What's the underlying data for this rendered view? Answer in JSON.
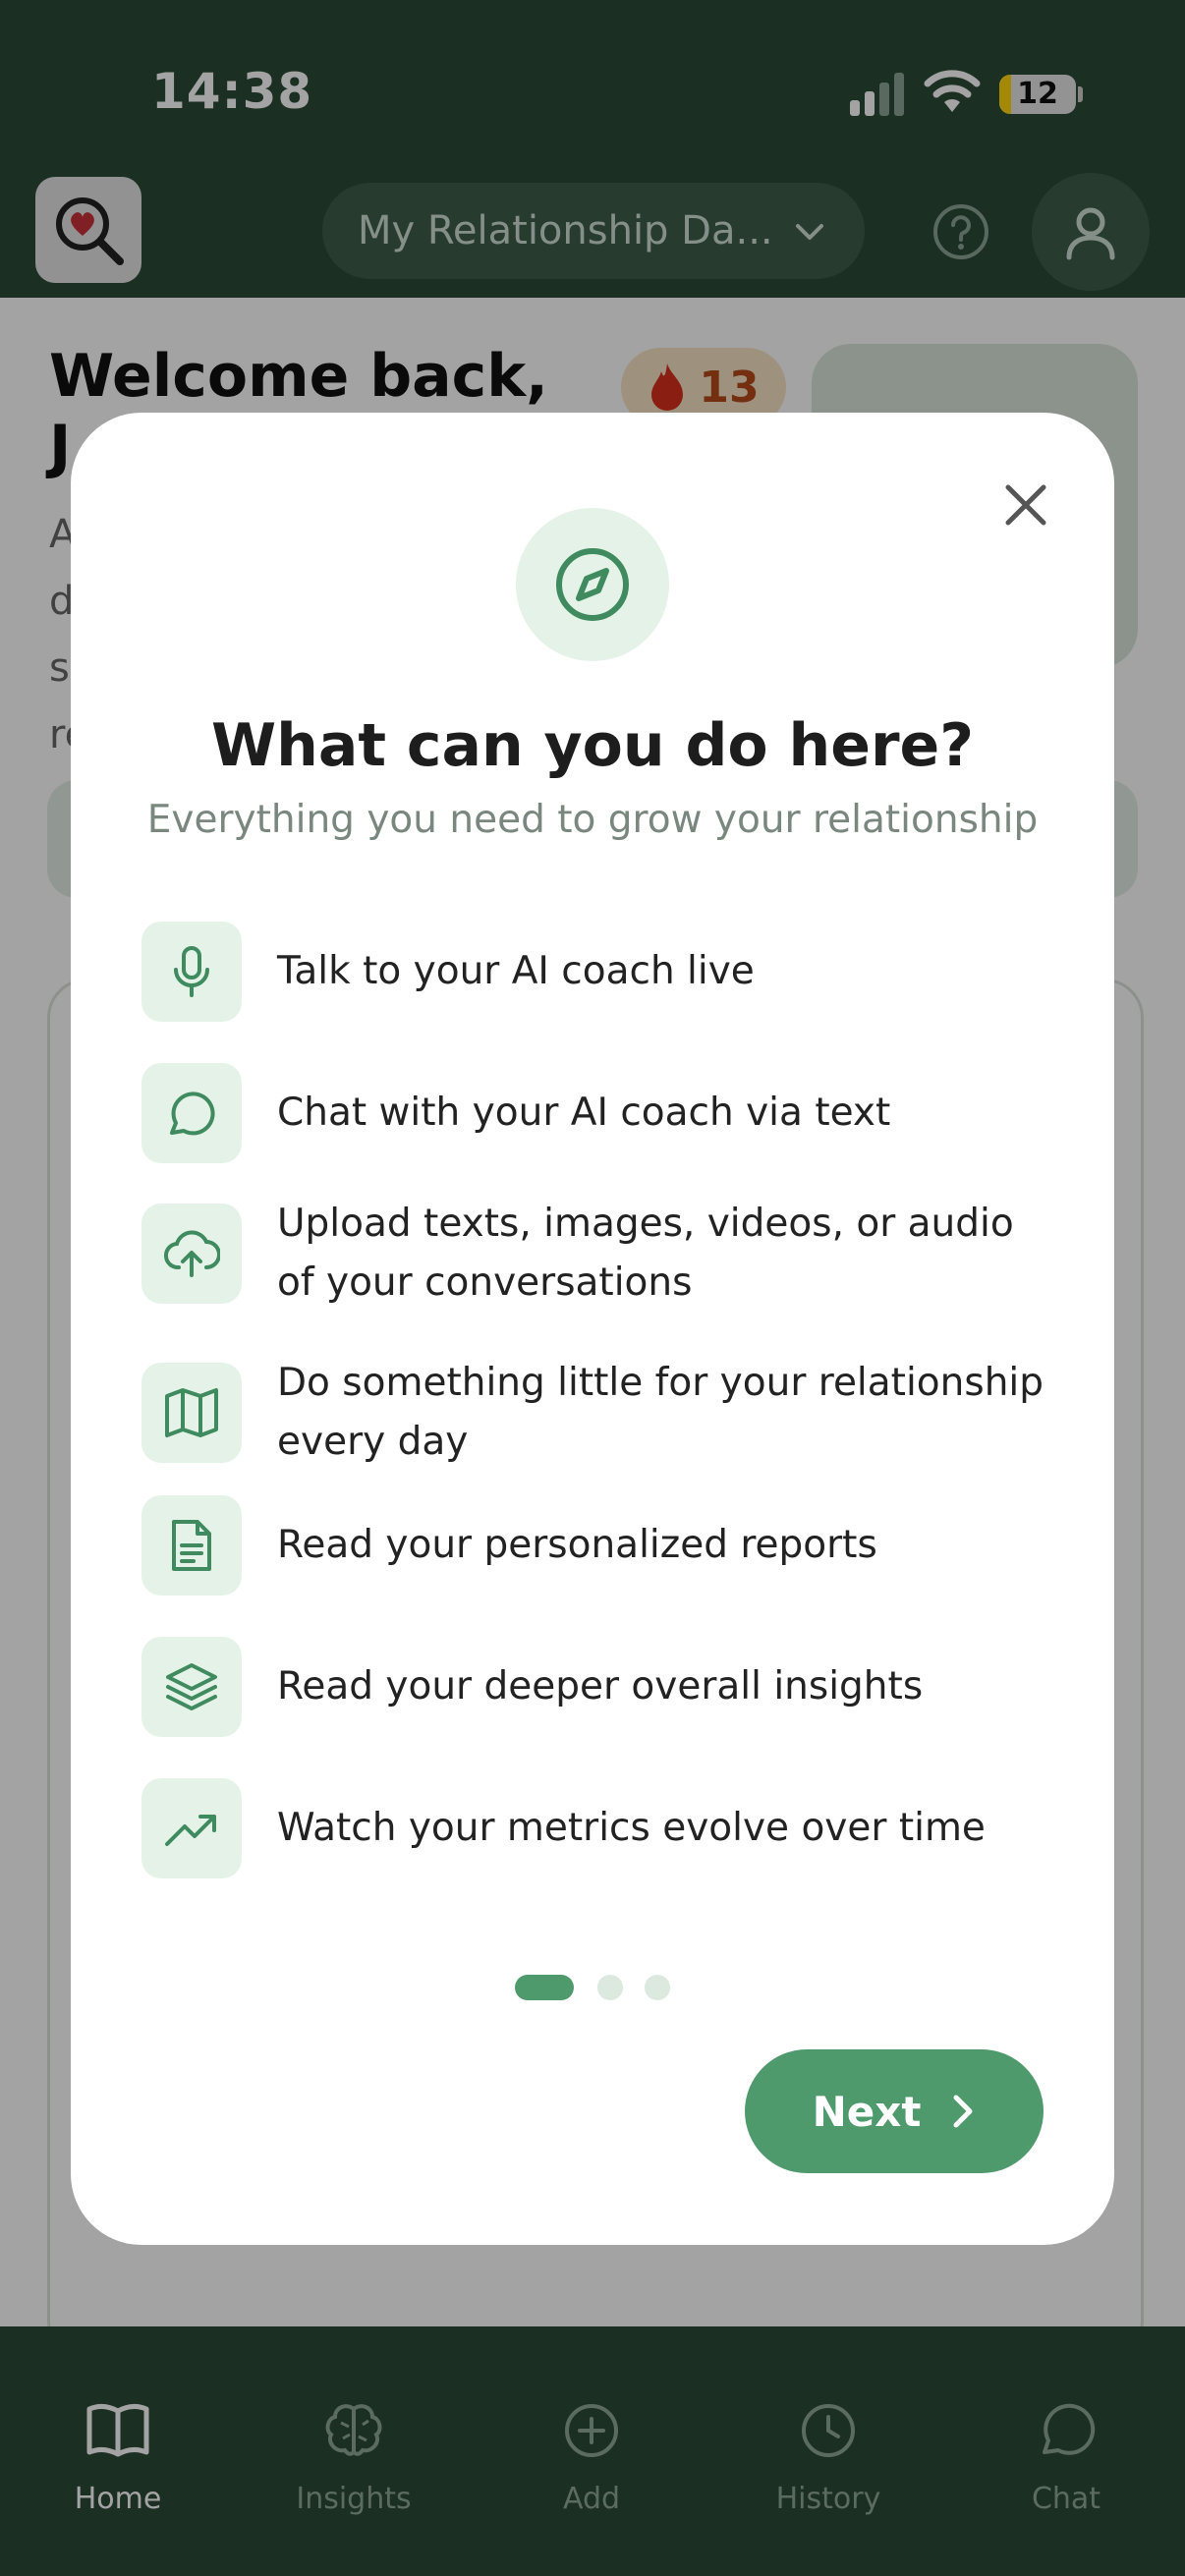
{
  "status_bar": {
    "time": "14:38",
    "battery_level": "12",
    "battery_color": "#ffd60a"
  },
  "header": {
    "relationship_selector": "My Relationship Da...",
    "logo_icon": "magnifier-heart-icon",
    "help_icon": "question-circle-icon",
    "profile_icon": "user-icon"
  },
  "background": {
    "welcome_line1": "Welcome back,",
    "welcome_line2": "J",
    "paragraph_fragments": [
      "A",
      "d",
      "s",
      "re"
    ],
    "streak_count": "13"
  },
  "modal": {
    "title": "What can you do here?",
    "subtitle": "Everything you need to grow your relationship",
    "header_icon": "compass-icon",
    "features": [
      {
        "icon": "microphone-icon",
        "label": "Talk to your AI coach live"
      },
      {
        "icon": "chat-bubble-icon",
        "label": "Chat with your AI coach via text"
      },
      {
        "icon": "cloud-upload-icon",
        "label": "Upload texts, images, videos, or audio of your conversations"
      },
      {
        "icon": "map-icon",
        "label": "Do something little for your relationship every day"
      },
      {
        "icon": "document-icon",
        "label": "Read your personalized reports"
      },
      {
        "icon": "layers-icon",
        "label": "Read your deeper overall insights"
      },
      {
        "icon": "trending-up-icon",
        "label": "Watch your metrics evolve over time"
      }
    ],
    "pagination": {
      "current": 1,
      "total": 3
    },
    "next_label": "Next"
  },
  "bottom_nav": {
    "items": [
      {
        "label": "Home",
        "icon": "book-icon",
        "active": true
      },
      {
        "label": "Insights",
        "icon": "brain-icon",
        "active": false
      },
      {
        "label": "Add",
        "icon": "plus-circle-icon",
        "active": false
      },
      {
        "label": "History",
        "icon": "clock-icon",
        "active": false
      },
      {
        "label": "Chat",
        "icon": "chat-bubble-icon",
        "active": false
      }
    ]
  },
  "colors": {
    "brand_dark": "#2c4a37",
    "accent_green": "#4f9a6d",
    "icon_bg": "#e4f2e8"
  }
}
